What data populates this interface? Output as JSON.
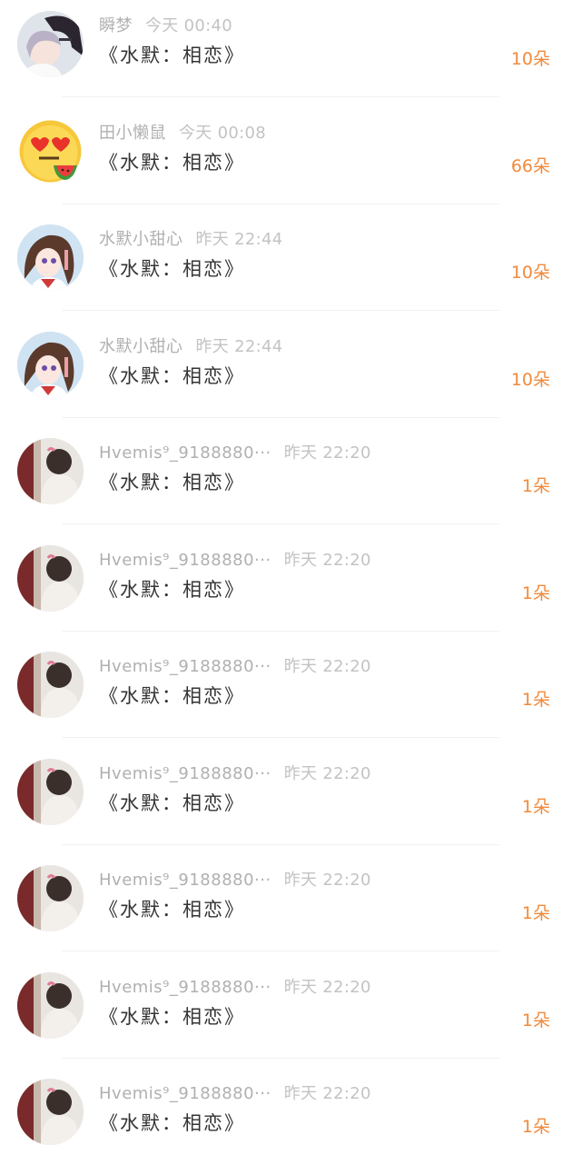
{
  "messages": [
    {
      "sender": "瞬梦",
      "time": "今天 00:40",
      "title": "《水默：相恋》",
      "count": "10朵",
      "avatar": "anime-dark-hair-icon"
    },
    {
      "sender": "田小懒鼠",
      "time": "今天 00:08",
      "title": "《水默：相恋》",
      "count": "66朵",
      "avatar": "heart-eyes-emoji-icon"
    },
    {
      "sender": "水默小甜心",
      "time": "昨天 22:44",
      "title": "《水默：相恋》",
      "count": "10朵",
      "avatar": "anime-girl-icon"
    },
    {
      "sender": "水默小甜心",
      "time": "昨天 22:44",
      "title": "《水默：相恋》",
      "count": "10朵",
      "avatar": "anime-girl-icon"
    },
    {
      "sender": "Hvemis⁹_9188880···",
      "time": "昨天 22:20",
      "title": "《水默：相恋》",
      "count": "1朵",
      "avatar": "photo-girl-icon"
    },
    {
      "sender": "Hvemis⁹_9188880···",
      "time": "昨天 22:20",
      "title": "《水默：相恋》",
      "count": "1朵",
      "avatar": "photo-girl-icon"
    },
    {
      "sender": "Hvemis⁹_9188880···",
      "time": "昨天 22:20",
      "title": "《水默：相恋》",
      "count": "1朵",
      "avatar": "photo-girl-icon"
    },
    {
      "sender": "Hvemis⁹_9188880···",
      "time": "昨天 22:20",
      "title": "《水默：相恋》",
      "count": "1朵",
      "avatar": "photo-girl-icon"
    },
    {
      "sender": "Hvemis⁹_9188880···",
      "time": "昨天 22:20",
      "title": "《水默：相恋》",
      "count": "1朵",
      "avatar": "photo-girl-icon"
    },
    {
      "sender": "Hvemis⁹_9188880···",
      "time": "昨天 22:20",
      "title": "《水默：相恋》",
      "count": "1朵",
      "avatar": "photo-girl-icon"
    },
    {
      "sender": "Hvemis⁹_9188880···",
      "time": "昨天 22:20",
      "title": "《水默：相恋》",
      "count": "1朵",
      "avatar": "photo-girl-icon"
    }
  ],
  "colors": {
    "count": "#f08a3c",
    "sender": "#b0b0b0",
    "title": "#333333"
  }
}
